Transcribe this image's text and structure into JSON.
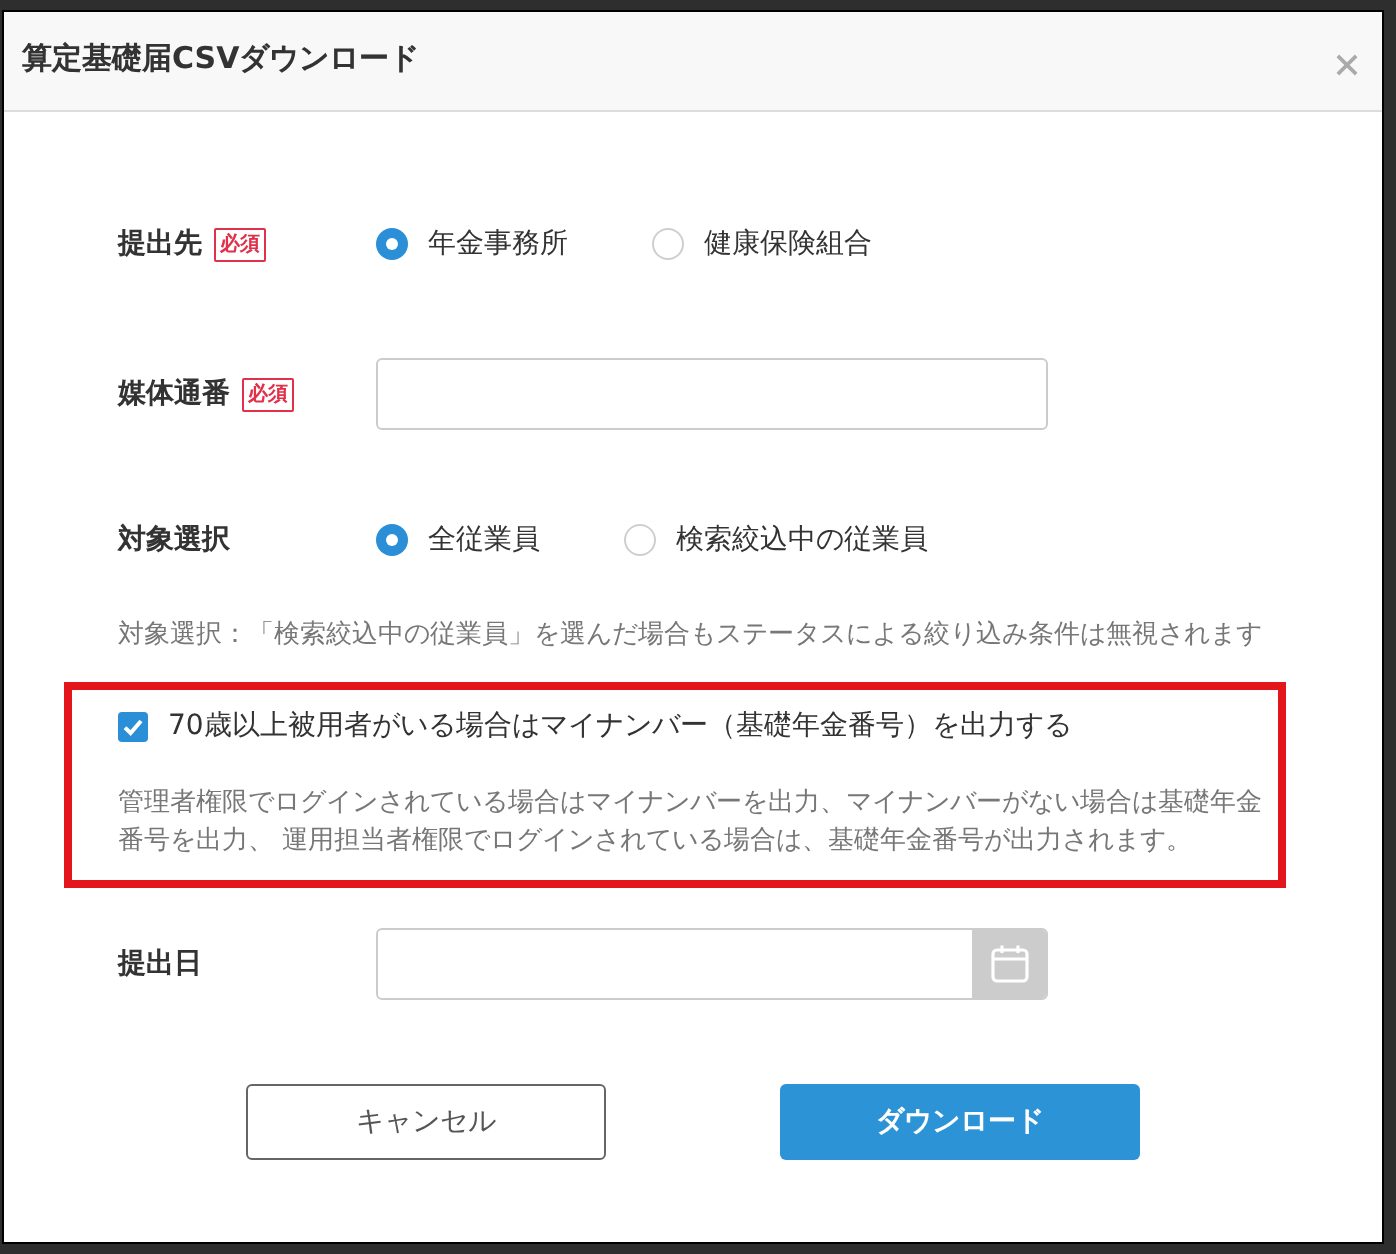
{
  "dialog": {
    "title": "算定基礎届CSVダウンロード"
  },
  "form": [
    {
      "kind": "radio",
      "label": "提出先",
      "badge": "必須",
      "options": [
        {
          "label": "年金事務所",
          "selected": true
        },
        {
          "label": "健康保険組合",
          "selected": false
        }
      ]
    },
    {
      "kind": "text",
      "label": "媒体通番",
      "badge": "必須"
    },
    {
      "kind": "radio",
      "label": "対象選択",
      "options": [
        {
          "label": "全従業員",
          "selected": true
        },
        {
          "label": "検索絞込中の従業員",
          "selected": false
        }
      ]
    },
    {
      "kind": "note",
      "text": "対象選択：「検索絞込中の従業員」を選んだ場合もステータスによる絞り込み条件は無視されます"
    },
    {
      "kind": "checkbox",
      "label": "70歳以上被用者がいる場合はマイナンバー（基礎年金番号）を出力する",
      "checked": true,
      "highlighted": true,
      "description": "管理者権限でログインされている場合はマイナンバーを出力、マイナンバーがない場合は基礎年金番号を出力、 運用担当者権限でログインされている場合は、基礎年金番号が出力されます。"
    },
    {
      "kind": "date",
      "label": "提出日"
    }
  ],
  "buttons": [
    {
      "label": "キャンセル",
      "kind": "secondary"
    },
    {
      "label": "ダウンロード",
      "kind": "primary"
    }
  ]
}
